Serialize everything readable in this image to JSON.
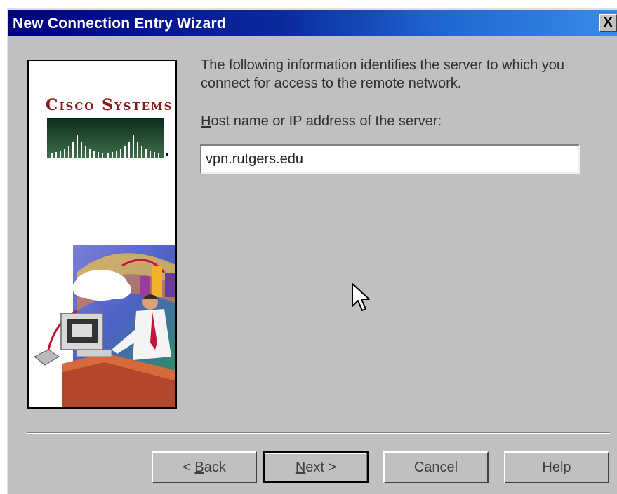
{
  "window": {
    "title": "New Connection Entry Wizard",
    "close_glyph": "X"
  },
  "left_panel": {
    "logo_text": "Cisco Systems",
    "logo_color": "#8b1a1a",
    "illustration_icon": "person-computer-network-illustration"
  },
  "main": {
    "description": "The following information identifies the server to which you connect for access to the remote network.",
    "host_label_accel": "H",
    "host_label_rest": "ost name or IP address of the server:",
    "host_value": "vpn.rutgers.edu"
  },
  "buttons": {
    "back_prefix": "< ",
    "back_accel": "B",
    "back_rest": "ack",
    "next_accel": "N",
    "next_rest": "ext >",
    "cancel": "Cancel",
    "help": "Help"
  },
  "colors": {
    "title_gradient_start": "#000080",
    "title_gradient_end": "#3a8ae6",
    "dialog_face": "#c0c0c0"
  },
  "cursor_icon": "arrow-cursor-icon"
}
